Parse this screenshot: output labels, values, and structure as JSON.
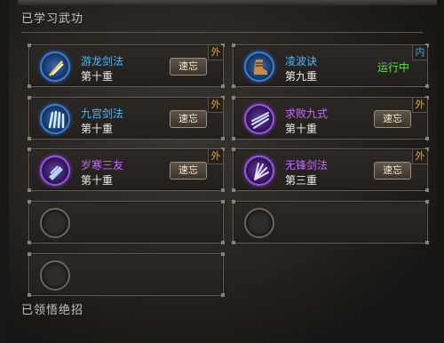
{
  "learned_section": {
    "title": "已学习武功"
  },
  "comprehended_section": {
    "title": "已领悟绝招"
  },
  "skills": [
    {
      "name": "游龙剑法",
      "level": "第十重",
      "type": "外",
      "action": "速忘",
      "color": "#4ab8ff",
      "icon": "sword-icon"
    },
    {
      "name": "凌波诀",
      "level": "第九重",
      "type": "内",
      "status": "运行中",
      "color": "#4ab8ff",
      "icon": "boot-icon"
    },
    {
      "name": "九宫剑法",
      "level": "第十重",
      "type": "外",
      "action": "速忘",
      "color": "#4ab8ff",
      "icon": "claw-icon"
    },
    {
      "name": "求败九式",
      "level": "第十重",
      "type": "外",
      "action": "速忘",
      "color": "#c66bff",
      "icon": "slash-icon"
    },
    {
      "name": "岁寒三友",
      "level": "第十重",
      "type": "外",
      "action": "速忘",
      "color": "#c66bff",
      "icon": "blade-icon"
    },
    {
      "name": "无锋剑法",
      "level": "第三重",
      "type": "外",
      "action": "速忘",
      "color": "#c66bff",
      "icon": "sword-fan-icon"
    }
  ]
}
